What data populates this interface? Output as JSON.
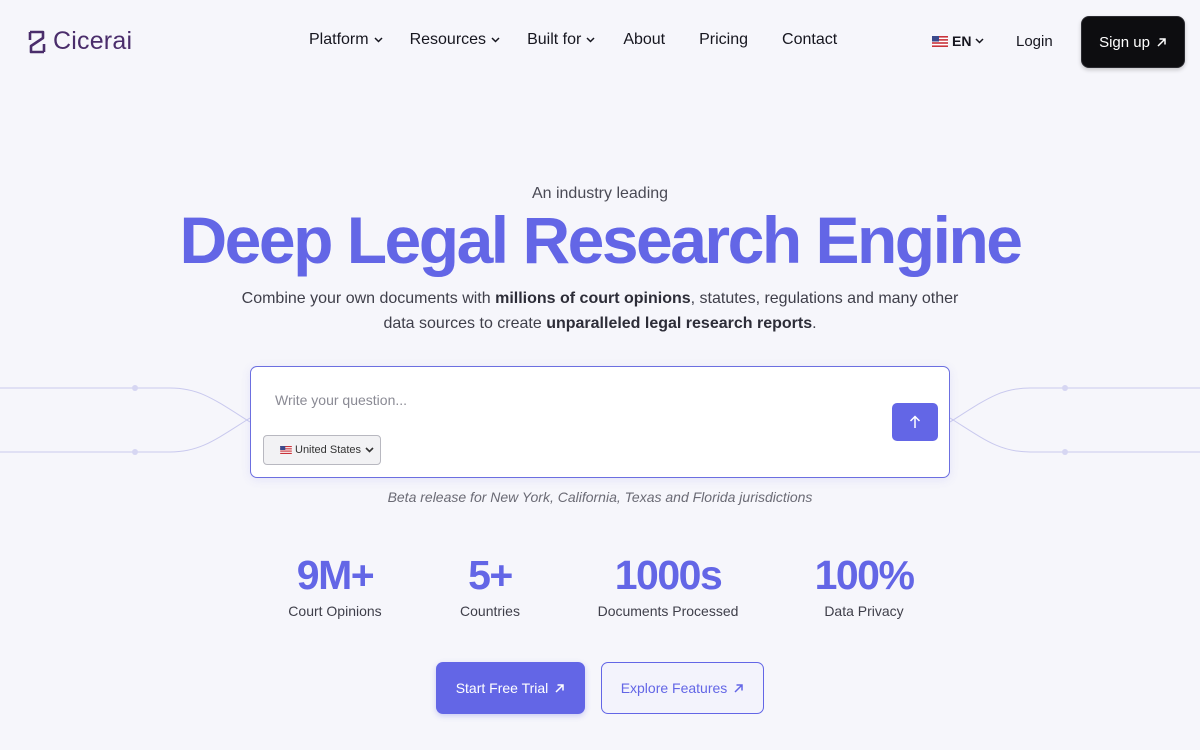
{
  "brand": {
    "name": "Cicerai",
    "logo_icon": "cicerai-logo-icon"
  },
  "nav": {
    "items": [
      {
        "label": "Platform",
        "dropdown": true
      },
      {
        "label": "Resources",
        "dropdown": true
      },
      {
        "label": "Built for",
        "dropdown": true
      },
      {
        "label": "About",
        "dropdown": false
      },
      {
        "label": "Pricing",
        "dropdown": false
      },
      {
        "label": "Contact",
        "dropdown": false
      }
    ],
    "language": "EN",
    "login": "Login",
    "signup": "Sign up"
  },
  "hero": {
    "eyebrow": "An industry leading",
    "headline": "Deep Legal Research Engine",
    "sub_part1": "Combine your own documents with ",
    "sub_bold1": "millions of court opinions",
    "sub_part2": ", statutes, regulations and many other data sources to create ",
    "sub_bold2": "unparalleled legal research reports",
    "sub_part3": "."
  },
  "search": {
    "placeholder": "Write your question...",
    "country": "United States"
  },
  "beta_note": "Beta release for New York, California, Texas and Florida jurisdictions",
  "stats": [
    {
      "value": "9M+",
      "label": "Court Opinions"
    },
    {
      "value": "5+",
      "label": "Countries"
    },
    {
      "value": "1000s",
      "label": "Documents Processed"
    },
    {
      "value": "100%",
      "label": "Data Privacy"
    }
  ],
  "cta": {
    "primary": "Start Free Trial",
    "secondary": "Explore Features"
  },
  "colors": {
    "accent": "#6366e6",
    "brand_text": "#4a2d6b",
    "background": "#f6f6fb",
    "signup_bg": "#0d0d10"
  }
}
